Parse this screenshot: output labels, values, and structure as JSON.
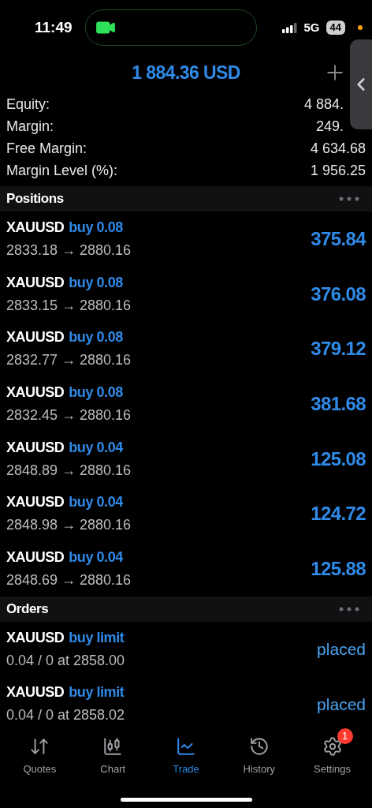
{
  "status_bar": {
    "time": "11:49",
    "network": "5G",
    "battery": "44"
  },
  "balance": "1 884.36 USD",
  "summary": [
    {
      "label": "Equity:",
      "value": "4 884."
    },
    {
      "label": "Margin:",
      "value": "249."
    },
    {
      "label": "Free Margin:",
      "value": "4 634.68"
    },
    {
      "label": "Margin Level (%):",
      "value": "1 956.25"
    }
  ],
  "positions": {
    "title": "Positions",
    "items": [
      {
        "symbol": "XAUUSD",
        "type": "buy 0.08",
        "prices": "2833.18 → 2880.16",
        "profit": "375.84"
      },
      {
        "symbol": "XAUUSD",
        "type": "buy 0.08",
        "prices": "2833.15 → 2880.16",
        "profit": "376.08"
      },
      {
        "symbol": "XAUUSD",
        "type": "buy 0.08",
        "prices": "2832.77 → 2880.16",
        "profit": "379.12"
      },
      {
        "symbol": "XAUUSD",
        "type": "buy 0.08",
        "prices": "2832.45 → 2880.16",
        "profit": "381.68"
      },
      {
        "symbol": "XAUUSD",
        "type": "buy 0.04",
        "prices": "2848.89 → 2880.16",
        "profit": "125.08"
      },
      {
        "symbol": "XAUUSD",
        "type": "buy 0.04",
        "prices": "2848.98 → 2880.16",
        "profit": "124.72"
      },
      {
        "symbol": "XAUUSD",
        "type": "buy 0.04",
        "prices": "2848.69 → 2880.16",
        "profit": "125.88"
      }
    ]
  },
  "orders": {
    "title": "Orders",
    "items": [
      {
        "symbol": "XAUUSD",
        "type": "buy limit",
        "details": "0.04 / 0 at 2858.00",
        "state": "placed"
      },
      {
        "symbol": "XAUUSD",
        "type": "buy limit",
        "details": "0.04 / 0 at 2858.02",
        "state": "placed"
      }
    ]
  },
  "tab_bar": [
    {
      "label": "Quotes",
      "kind": "quotes",
      "selected": false
    },
    {
      "label": "Chart",
      "kind": "chart",
      "selected": false
    },
    {
      "label": "Trade",
      "kind": "trade",
      "selected": true
    },
    {
      "label": "History",
      "kind": "history",
      "selected": false
    },
    {
      "label": "Settings",
      "kind": "settings",
      "selected": false,
      "badge": "1"
    }
  ]
}
